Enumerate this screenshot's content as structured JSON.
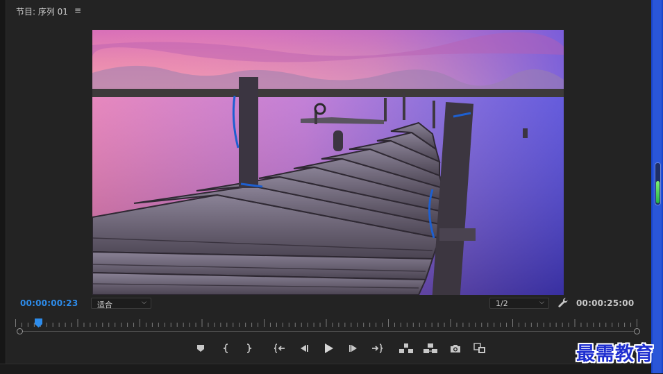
{
  "panel": {
    "title": "节目: 序列 01",
    "menu_icon": "≡"
  },
  "timecode": {
    "current": "00:00:00:23",
    "duration": "00:00:25:00",
    "current_color": "#2d8ceb"
  },
  "zoom_select": {
    "value": "适合",
    "chevron": "⌵"
  },
  "resolution_select": {
    "value": "1/2",
    "chevron": "⌵"
  },
  "icons": {
    "settings": "wrench-icon",
    "add_marker": "marker-icon",
    "mark_in": "mark-in-icon",
    "mark_out": "mark-out-icon",
    "go_to_in": "go-to-in-icon",
    "step_back": "step-back-icon",
    "play": "play-icon",
    "step_forward": "step-forward-icon",
    "go_to_out": "go-to-out-icon",
    "lift": "lift-icon",
    "extract": "extract-icon",
    "export_frame": "camera-icon",
    "compare": "compare-view-icon"
  },
  "playback_position": 0.037,
  "watermark": "最需教育",
  "colors": {
    "panel_bg": "#232323",
    "accent": "#2d8ceb",
    "right_bar": "#1845c9",
    "watermark": "#1f2fd0"
  }
}
